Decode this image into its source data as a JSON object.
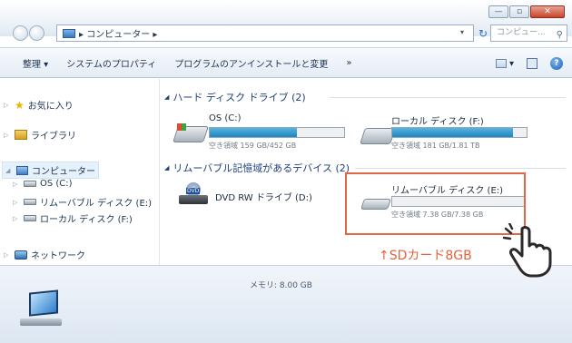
{
  "window": {
    "controls": {
      "minimize": "—",
      "maximize": "▫",
      "close": "✕"
    }
  },
  "address": {
    "path": "▸ コンピューター ▸",
    "dropdown": "▾",
    "refresh": "↻",
    "search_placeholder": "コンピュー...",
    "search_glyph": "⚲"
  },
  "toolbar": {
    "items": [
      "整理 ▾",
      "システムのプロパティ",
      "プログラムのアンインストールと変更",
      "»"
    ],
    "view_dropdown": "▾",
    "help": "?"
  },
  "navpane": {
    "favorites": "お気に入り",
    "libraries": "ライブラリ",
    "computer": "コンピューター",
    "drives": [
      "OS (C:)",
      "リムーバブル ディスク (E:)",
      "ローカル ディスク (F:)"
    ],
    "network": "ネットワーク"
  },
  "content": {
    "hdd_group": "ハード ディスク ドライブ (2)",
    "removable_group": "リムーバブル記憶域があるデバイス (2)",
    "drives": [
      {
        "name": "OS (C:)",
        "free": "空き領域 159 GB/452 GB",
        "used_fraction": 0.65
      },
      {
        "name": "ローカル ディスク (F:)",
        "free": "空き領域 181 GB/1.81 TB",
        "used_fraction": 0.9
      },
      {
        "name": "DVD RW ドライブ (D:)"
      },
      {
        "name": "リムーバブル ディスク (E:)",
        "free": "空き領域 7.38 GB/7.38 GB",
        "used_fraction": 0.0
      }
    ]
  },
  "details": {
    "memory": "メモリ: 8.00 GB"
  },
  "annotation": {
    "text": "↑SDカード8GB",
    "color": "#e2633f"
  },
  "colors": {
    "accent": "#1f86c1",
    "highlight": "#e2674a"
  }
}
